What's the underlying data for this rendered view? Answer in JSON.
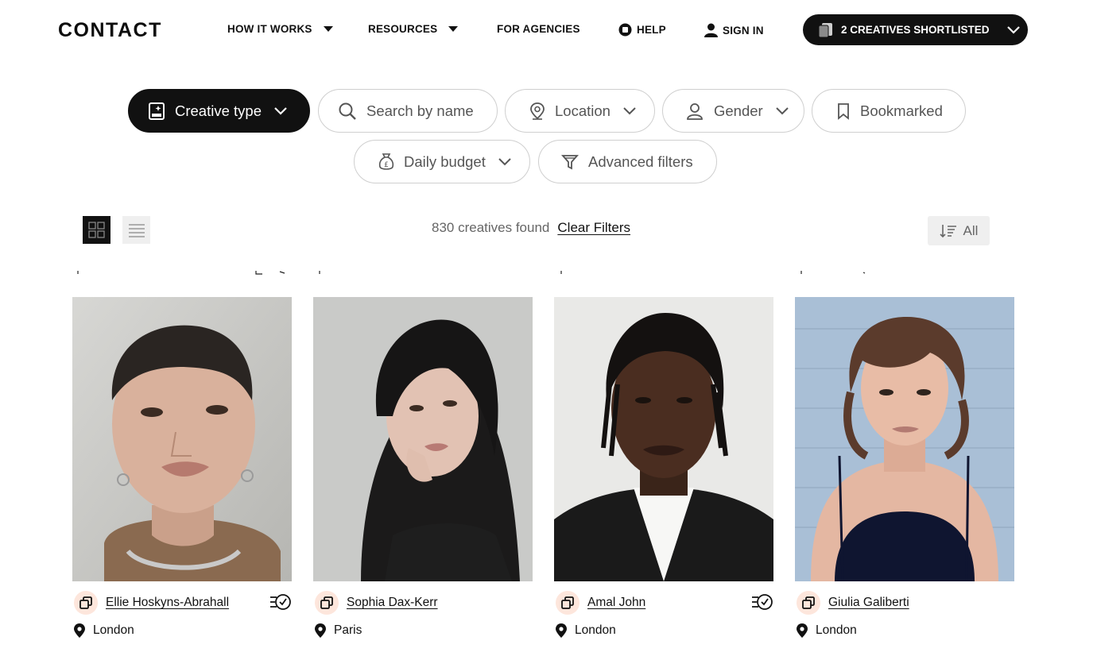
{
  "header": {
    "logo": "CONTACT",
    "nav": [
      {
        "label": "HOW IT WORKS"
      },
      {
        "label": "RESOURCES"
      },
      {
        "label": "FOR AGENCIES"
      },
      {
        "label": "HELP"
      },
      {
        "label": "SIGN IN"
      }
    ],
    "shortlist_label": "2 CREATIVES SHORTLISTED"
  },
  "filters": {
    "creative_type": "Creative type",
    "search_placeholder": "Search by name",
    "location": "Location",
    "gender": "Gender",
    "bookmarked": "Bookmarked",
    "daily_budget": "Daily budget",
    "advanced": "Advanced filters"
  },
  "toolbar": {
    "results_text": "830 creatives found",
    "clear_filters": "Clear Filters",
    "sort_label": "All"
  },
  "creatives": [
    {
      "name": "Ellie Hoskyns-Abrahall",
      "location": "London",
      "fast_response": true
    },
    {
      "name": "Sophia Dax-Kerr",
      "location": "Paris",
      "fast_response": false
    },
    {
      "name": "Amal John",
      "location": "London",
      "fast_response": true
    },
    {
      "name": "Giulia Galiberti",
      "location": "London",
      "fast_response": false
    }
  ],
  "colors": {
    "accent_dark": "#111111",
    "badge_bg": "#fde6dc",
    "pill_border": "#cfcfcf",
    "muted_text": "#666666"
  }
}
